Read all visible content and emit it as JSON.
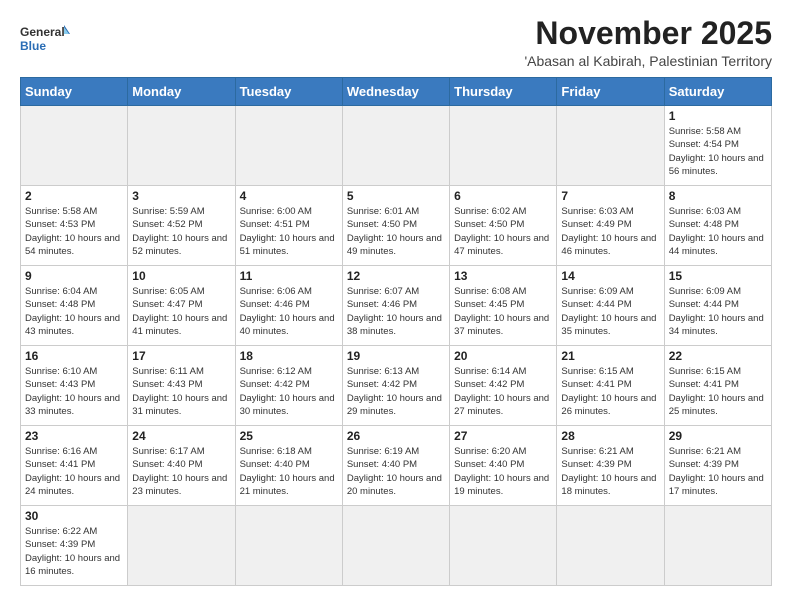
{
  "logo": {
    "text_general": "General",
    "text_blue": "Blue"
  },
  "header": {
    "month_year": "November 2025",
    "location": "'Abasan al Kabirah, Palestinian Territory"
  },
  "weekdays": [
    "Sunday",
    "Monday",
    "Tuesday",
    "Wednesday",
    "Thursday",
    "Friday",
    "Saturday"
  ],
  "days": [
    {
      "day": null,
      "info": null
    },
    {
      "day": null,
      "info": null
    },
    {
      "day": null,
      "info": null
    },
    {
      "day": null,
      "info": null
    },
    {
      "day": null,
      "info": null
    },
    {
      "day": null,
      "info": null
    },
    {
      "day": "1",
      "info": "Sunrise: 5:58 AM\nSunset: 4:54 PM\nDaylight: 10 hours and 56 minutes."
    },
    {
      "day": "2",
      "info": "Sunrise: 5:58 AM\nSunset: 4:53 PM\nDaylight: 10 hours and 54 minutes."
    },
    {
      "day": "3",
      "info": "Sunrise: 5:59 AM\nSunset: 4:52 PM\nDaylight: 10 hours and 52 minutes."
    },
    {
      "day": "4",
      "info": "Sunrise: 6:00 AM\nSunset: 4:51 PM\nDaylight: 10 hours and 51 minutes."
    },
    {
      "day": "5",
      "info": "Sunrise: 6:01 AM\nSunset: 4:50 PM\nDaylight: 10 hours and 49 minutes."
    },
    {
      "day": "6",
      "info": "Sunrise: 6:02 AM\nSunset: 4:50 PM\nDaylight: 10 hours and 47 minutes."
    },
    {
      "day": "7",
      "info": "Sunrise: 6:03 AM\nSunset: 4:49 PM\nDaylight: 10 hours and 46 minutes."
    },
    {
      "day": "8",
      "info": "Sunrise: 6:03 AM\nSunset: 4:48 PM\nDaylight: 10 hours and 44 minutes."
    },
    {
      "day": "9",
      "info": "Sunrise: 6:04 AM\nSunset: 4:48 PM\nDaylight: 10 hours and 43 minutes."
    },
    {
      "day": "10",
      "info": "Sunrise: 6:05 AM\nSunset: 4:47 PM\nDaylight: 10 hours and 41 minutes."
    },
    {
      "day": "11",
      "info": "Sunrise: 6:06 AM\nSunset: 4:46 PM\nDaylight: 10 hours and 40 minutes."
    },
    {
      "day": "12",
      "info": "Sunrise: 6:07 AM\nSunset: 4:46 PM\nDaylight: 10 hours and 38 minutes."
    },
    {
      "day": "13",
      "info": "Sunrise: 6:08 AM\nSunset: 4:45 PM\nDaylight: 10 hours and 37 minutes."
    },
    {
      "day": "14",
      "info": "Sunrise: 6:09 AM\nSunset: 4:44 PM\nDaylight: 10 hours and 35 minutes."
    },
    {
      "day": "15",
      "info": "Sunrise: 6:09 AM\nSunset: 4:44 PM\nDaylight: 10 hours and 34 minutes."
    },
    {
      "day": "16",
      "info": "Sunrise: 6:10 AM\nSunset: 4:43 PM\nDaylight: 10 hours and 33 minutes."
    },
    {
      "day": "17",
      "info": "Sunrise: 6:11 AM\nSunset: 4:43 PM\nDaylight: 10 hours and 31 minutes."
    },
    {
      "day": "18",
      "info": "Sunrise: 6:12 AM\nSunset: 4:42 PM\nDaylight: 10 hours and 30 minutes."
    },
    {
      "day": "19",
      "info": "Sunrise: 6:13 AM\nSunset: 4:42 PM\nDaylight: 10 hours and 29 minutes."
    },
    {
      "day": "20",
      "info": "Sunrise: 6:14 AM\nSunset: 4:42 PM\nDaylight: 10 hours and 27 minutes."
    },
    {
      "day": "21",
      "info": "Sunrise: 6:15 AM\nSunset: 4:41 PM\nDaylight: 10 hours and 26 minutes."
    },
    {
      "day": "22",
      "info": "Sunrise: 6:15 AM\nSunset: 4:41 PM\nDaylight: 10 hours and 25 minutes."
    },
    {
      "day": "23",
      "info": "Sunrise: 6:16 AM\nSunset: 4:41 PM\nDaylight: 10 hours and 24 minutes."
    },
    {
      "day": "24",
      "info": "Sunrise: 6:17 AM\nSunset: 4:40 PM\nDaylight: 10 hours and 23 minutes."
    },
    {
      "day": "25",
      "info": "Sunrise: 6:18 AM\nSunset: 4:40 PM\nDaylight: 10 hours and 21 minutes."
    },
    {
      "day": "26",
      "info": "Sunrise: 6:19 AM\nSunset: 4:40 PM\nDaylight: 10 hours and 20 minutes."
    },
    {
      "day": "27",
      "info": "Sunrise: 6:20 AM\nSunset: 4:40 PM\nDaylight: 10 hours and 19 minutes."
    },
    {
      "day": "28",
      "info": "Sunrise: 6:21 AM\nSunset: 4:39 PM\nDaylight: 10 hours and 18 minutes."
    },
    {
      "day": "29",
      "info": "Sunrise: 6:21 AM\nSunset: 4:39 PM\nDaylight: 10 hours and 17 minutes."
    },
    {
      "day": "30",
      "info": "Sunrise: 6:22 AM\nSunset: 4:39 PM\nDaylight: 10 hours and 16 minutes."
    }
  ]
}
